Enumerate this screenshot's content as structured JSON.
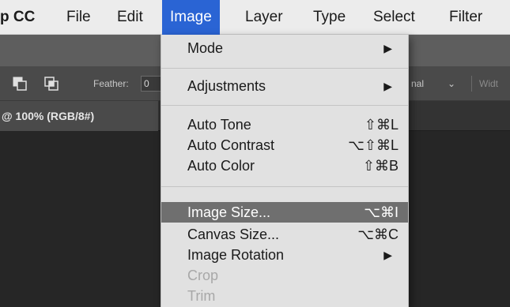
{
  "menubar": {
    "app": "p CC",
    "items": [
      "File",
      "Edit",
      "Image",
      "Layer",
      "Type",
      "Select",
      "Filter"
    ]
  },
  "optionsbar": {
    "feather_label": "Feather:",
    "feather_value": "0",
    "style_value": "nal",
    "style_chevron": "⌄",
    "width_label": "Widt"
  },
  "document": {
    "tab_title": "@ 100% (RGB/8#)"
  },
  "image_menu": {
    "mode": {
      "label": "Mode",
      "arrow": "▶"
    },
    "adjustments": {
      "label": "Adjustments",
      "arrow": "▶"
    },
    "auto_tone": {
      "label": "Auto Tone",
      "shortcut": "⇧⌘L"
    },
    "auto_contrast": {
      "label": "Auto Contrast",
      "shortcut": "⌥⇧⌘L"
    },
    "auto_color": {
      "label": "Auto Color",
      "shortcut": "⇧⌘B"
    },
    "image_size": {
      "label": "Image Size...",
      "shortcut": "⌥⌘I"
    },
    "canvas_size": {
      "label": "Canvas Size...",
      "shortcut": "⌥⌘C"
    },
    "image_rotation": {
      "label": "Image Rotation",
      "arrow": "▶"
    },
    "crop": {
      "label": "Crop"
    },
    "trim": {
      "label": "Trim"
    }
  }
}
